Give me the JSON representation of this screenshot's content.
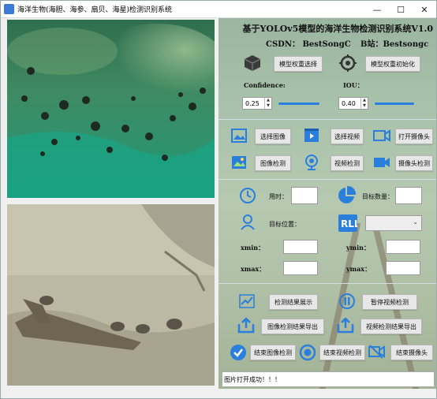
{
  "window": {
    "title": "海洋生物(海胆、海参、扇贝、海星)检测识别系统",
    "minimize": "—",
    "maximize": "☐",
    "close": "✕"
  },
  "header": {
    "title": "基于YOLOv5模型的海洋生物检测识别系统V1.0",
    "csdn": "CSDN：  BestSongC",
    "bzhan": "B站：Bestsongc"
  },
  "model": {
    "select_label": "模型权重选择",
    "init_label": "模型权重初始化"
  },
  "params": {
    "confidence_label": "Confidence:",
    "confidence_value": "0.25",
    "confidence_fraction": 0.25,
    "iou_label": "IOU：",
    "iou_value": "0.40",
    "iou_fraction": 0.4
  },
  "media": {
    "select_image": "选择图像",
    "select_video": "选择视频",
    "open_camera": "打开摄像头",
    "detect_image": "图像检测",
    "detect_video": "视频检测",
    "detect_camera": "摄像头检测"
  },
  "results": {
    "time_label": "用时：",
    "count_label": "目标数量：",
    "position_label": "目标位置：",
    "xmin_label": "xmin：",
    "ymin_label": "ymin：",
    "xmax_label": "xmax：",
    "ymax_label": "ymax：",
    "time_value": "",
    "count_value": "",
    "target_select": "",
    "xmin": "",
    "ymin": "",
    "xmax": "",
    "ymax": ""
  },
  "actions": {
    "show_results": "检测结果展示",
    "pause_video": "暂停视频检测",
    "export_image": "图像检测结果导出",
    "export_video": "视频检测结果导出",
    "end_image": "结束图像检测",
    "end_video": "结束视频检测",
    "end_camera": "结束摄像头"
  },
  "status": {
    "message": "图片打开成功！！！"
  },
  "colors": {
    "icon_blue": "#2a7fdc",
    "slider": "#2a7fdc"
  }
}
